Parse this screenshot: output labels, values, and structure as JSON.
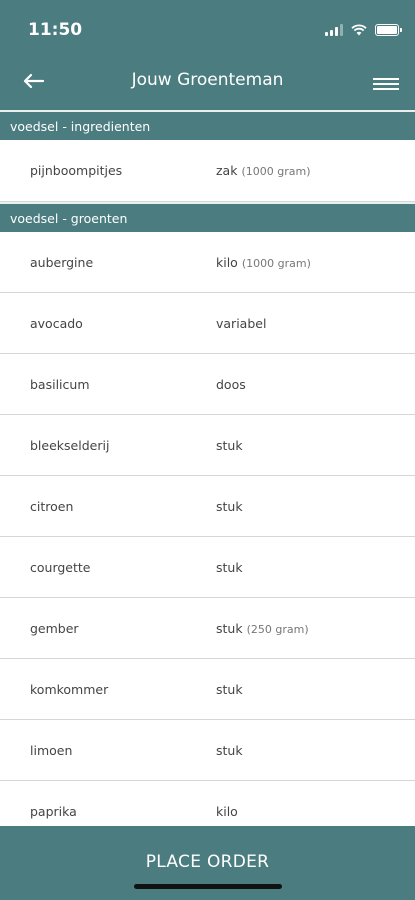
{
  "status_bar": {
    "time": "11:50"
  },
  "header": {
    "title": "Jouw Groenteman"
  },
  "sections": [
    {
      "title": "voedsel - ingredienten",
      "items": [
        {
          "name": "pijnboompitjes",
          "unit": "zak",
          "detail": "(1000 gram)"
        }
      ]
    },
    {
      "title": "voedsel - groenten",
      "items": [
        {
          "name": "aubergine",
          "unit": "kilo",
          "detail": "(1000 gram)"
        },
        {
          "name": "avocado",
          "unit": "variabel",
          "detail": ""
        },
        {
          "name": "basilicum",
          "unit": "doos",
          "detail": ""
        },
        {
          "name": "bleekselderij",
          "unit": "stuk",
          "detail": ""
        },
        {
          "name": "citroen",
          "unit": "stuk",
          "detail": ""
        },
        {
          "name": "courgette",
          "unit": "stuk",
          "detail": ""
        },
        {
          "name": "gember",
          "unit": "stuk",
          "detail": "(250 gram)"
        },
        {
          "name": "komkommer",
          "unit": "stuk",
          "detail": ""
        },
        {
          "name": "limoen",
          "unit": "stuk",
          "detail": ""
        },
        {
          "name": "paprika",
          "unit": "kilo",
          "detail": ""
        }
      ]
    }
  ],
  "footer": {
    "order_label": "PLACE ORDER"
  },
  "colors": {
    "primary": "#4a7c80",
    "divider": "#d6d6d6"
  }
}
